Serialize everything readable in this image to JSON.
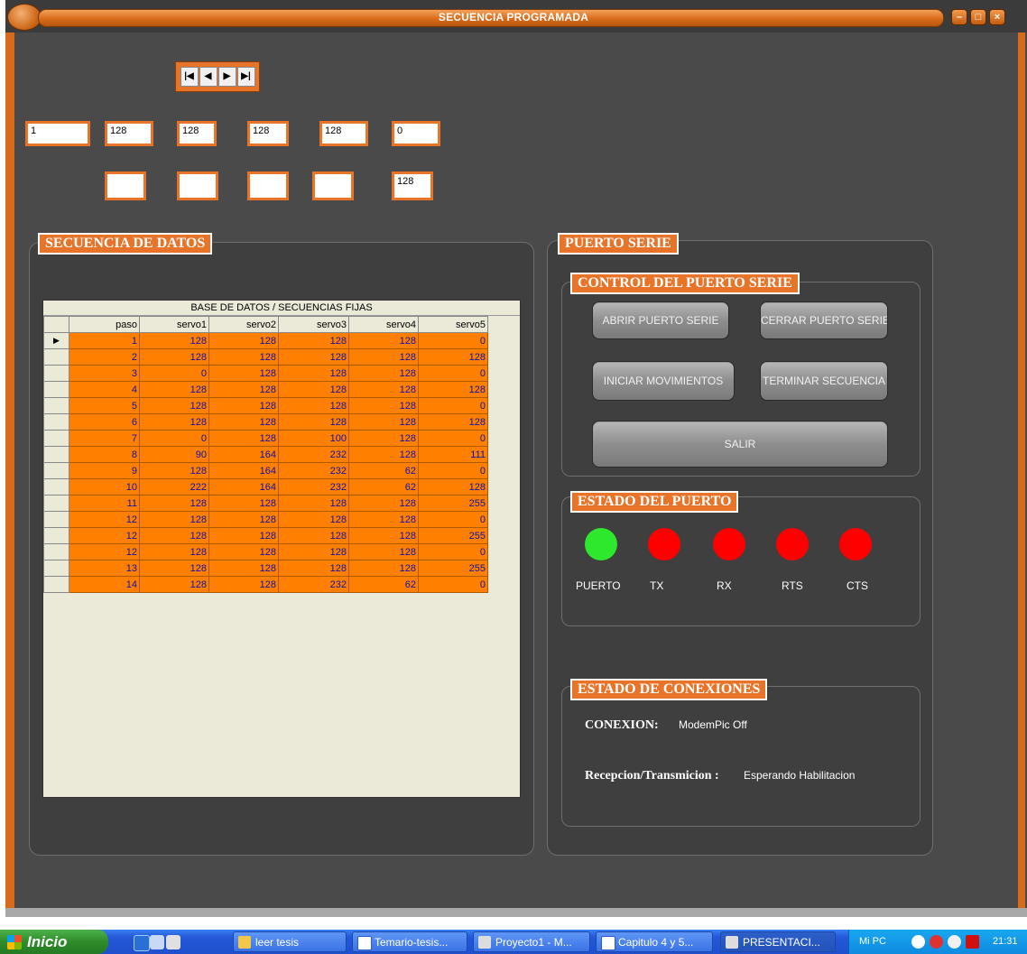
{
  "window": {
    "title": "SECUENCIA PROGRAMADA"
  },
  "navigator": {
    "buttons": [
      "|◀",
      "◀",
      "▶",
      "▶|"
    ]
  },
  "fields": {
    "row1": [
      "1",
      "128",
      "128",
      "128",
      "128",
      "0"
    ],
    "row2": [
      "",
      "",
      "",
      "",
      "128"
    ]
  },
  "secuencia": {
    "title": "SECUENCIA DE DATOS",
    "grid_caption": "BASE DE DATOS   /   SECUENCIAS FIJAS",
    "columns": [
      "paso",
      "servo1",
      "servo2",
      "servo3",
      "servo4",
      "servo5"
    ],
    "rows": [
      [
        "1",
        "128",
        "128",
        "128",
        "128",
        "0"
      ],
      [
        "2",
        "128",
        "128",
        "128",
        "128",
        "128"
      ],
      [
        "3",
        "0",
        "128",
        "128",
        "128",
        "0"
      ],
      [
        "4",
        "128",
        "128",
        "128",
        "128",
        "128"
      ],
      [
        "5",
        "128",
        "128",
        "128",
        "128",
        "0"
      ],
      [
        "6",
        "128",
        "128",
        "128",
        "128",
        "128"
      ],
      [
        "7",
        "0",
        "128",
        "100",
        "128",
        "0"
      ],
      [
        "8",
        "90",
        "164",
        "232",
        "128",
        "111"
      ],
      [
        "9",
        "128",
        "164",
        "232",
        "62",
        "0"
      ],
      [
        "10",
        "222",
        "164",
        "232",
        "62",
        "128"
      ],
      [
        "11",
        "128",
        "128",
        "128",
        "128",
        "255"
      ],
      [
        "12",
        "128",
        "128",
        "128",
        "128",
        "0"
      ],
      [
        "12",
        "128",
        "128",
        "128",
        "128",
        "255"
      ],
      [
        "12",
        "128",
        "128",
        "128",
        "128",
        "0"
      ],
      [
        "13",
        "128",
        "128",
        "128",
        "128",
        "255"
      ],
      [
        "14",
        "128",
        "128",
        "232",
        "62",
        "0"
      ]
    ],
    "current_row_marker": "▶"
  },
  "puerto": {
    "title": "PUERTO SERIE",
    "control_title": "CONTROL DEL PUERTO SERIE",
    "buttons": {
      "abrir": "ABRIR PUERTO SERIE",
      "cerrar": "CERRAR PUERTO SERIE",
      "iniciar": "INICIAR MOVIMIENTOS",
      "terminar": "TERMINAR SECUENCIA",
      "salir": "SALIR"
    },
    "estado_title": "ESTADO DEL PUERTO",
    "leds": [
      {
        "label": "PUERTO",
        "color": "#2ee82e"
      },
      {
        "label": "TX",
        "color": "#ff0000"
      },
      {
        "label": "RX",
        "color": "#ff0000"
      },
      {
        "label": "RTS",
        "color": "#ff0000"
      },
      {
        "label": "CTS",
        "color": "#ff0000"
      }
    ],
    "conexiones_title": "ESTADO DE CONEXIONES",
    "conexion_label": "CONEXION:",
    "conexion_value": "ModemPic Off",
    "rxtx_label": "Recepcion/Transmicion :",
    "rxtx_value": "Esperando Habilitacion"
  },
  "taskbar": {
    "start": "Inicio",
    "tasks": [
      "leer tesis",
      "Temario-tesis...",
      "Proyecto1 - M...",
      "Capitulo 4 y 5...",
      "PRESENTACI..."
    ],
    "tray_label": "Mi PC",
    "clock": "21:31"
  },
  "colors": {
    "accent": "#e8742a",
    "grid_cell": "#ff8000",
    "grid_text": "#1010b0",
    "led_on": "#2ee82e",
    "led_off": "#ff0000"
  }
}
